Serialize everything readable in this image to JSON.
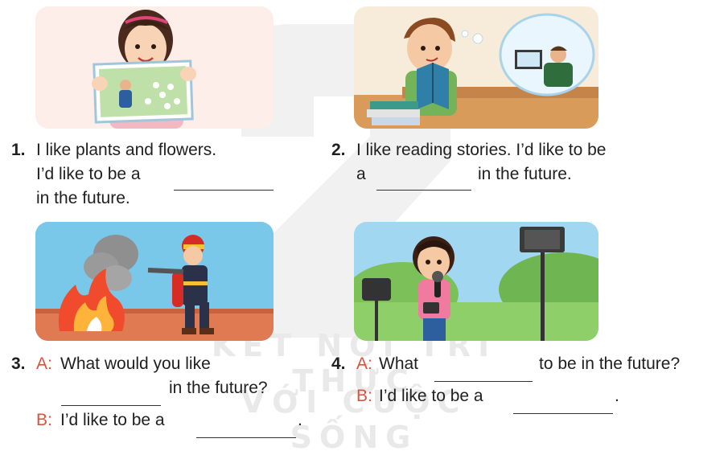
{
  "watermark": {
    "line1": "KẾT NỐI TRI THỨC",
    "line2": "VỚI CUỘC SỐNG"
  },
  "exercises": [
    {
      "number": "1.",
      "lines": [
        "I like plants and flowers.",
        "I’d like to be a",
        "in the future."
      ]
    },
    {
      "number": "2.",
      "lines": [
        "I like reading stories. I’d like to be",
        "a",
        "in the future."
      ]
    },
    {
      "number": "3.",
      "speaker_a": "A:",
      "a_text": "What would you like",
      "a_text2": "in the future?",
      "speaker_b": "B:",
      "b_text": "I’d like to be a",
      "end": "."
    },
    {
      "number": "4.",
      "speaker_a": "A:",
      "a_text": "What",
      "a_text2": "to be in the future?",
      "speaker_b": "B:",
      "b_text": "I’d like to be a",
      "end": "."
    }
  ],
  "colors": {
    "speaker": "#d9533c",
    "picture_bg_1": "#fdeeea",
    "picture_bg_2": "#f7ecd9",
    "sky": "#6ec5ea",
    "grass": "#8fcf6a"
  }
}
